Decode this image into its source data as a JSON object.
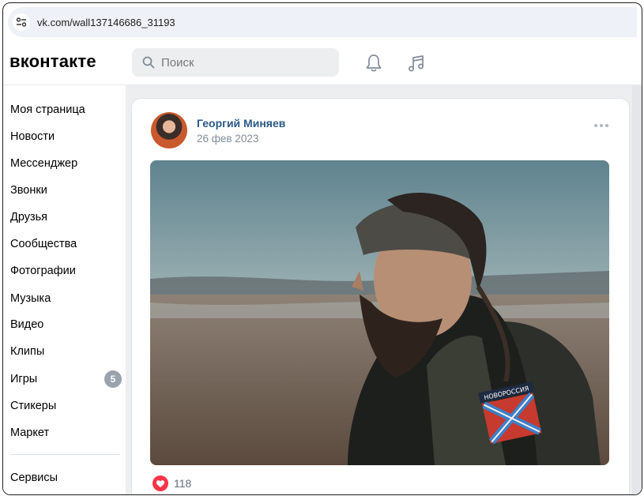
{
  "browser": {
    "url": "vk.com/wall137146686_31193"
  },
  "header": {
    "logo": "вконтакте",
    "search_placeholder": "Поиск"
  },
  "sidebar": {
    "items": [
      {
        "label": "Моя страница"
      },
      {
        "label": "Новости"
      },
      {
        "label": "Мессенджер"
      },
      {
        "label": "Звонки"
      },
      {
        "label": "Друзья"
      },
      {
        "label": "Сообщества"
      },
      {
        "label": "Фотографии"
      },
      {
        "label": "Музыка"
      },
      {
        "label": "Видео"
      },
      {
        "label": "Клипы"
      },
      {
        "label": "Игры",
        "badge": "5"
      },
      {
        "label": "Стикеры"
      },
      {
        "label": "Маркет"
      }
    ],
    "services": "Сервисы"
  },
  "post": {
    "author": "Георгий Миняев",
    "date": "26 фев 2023",
    "photo_patch_text": "НОВОРОССИЯ",
    "likes": "118"
  },
  "colors": {
    "link": "#2a5885",
    "like": "#ff3347",
    "badge": "#99a2ad"
  }
}
